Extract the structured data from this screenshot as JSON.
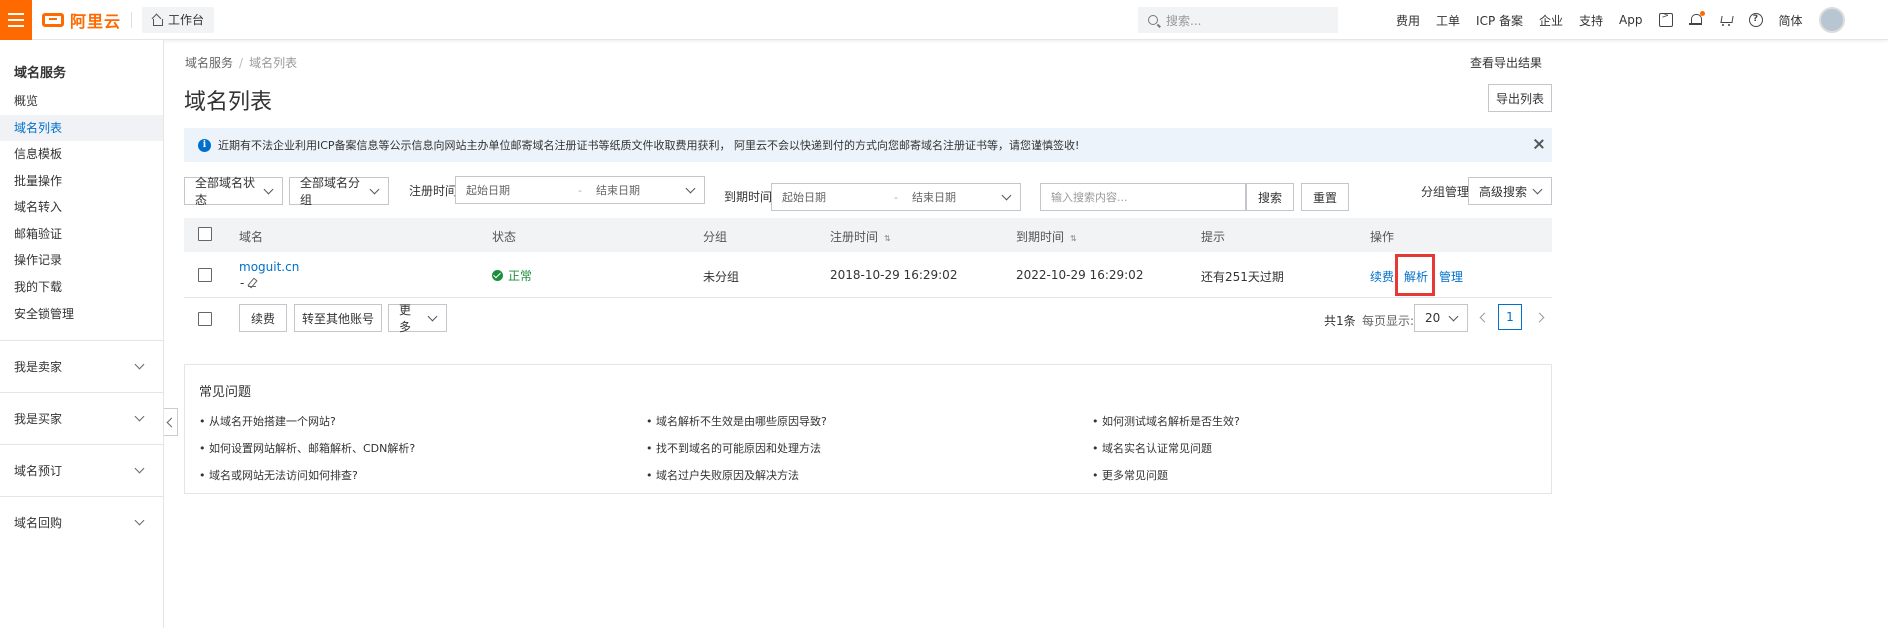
{
  "topbar": {
    "brand": "阿里云",
    "workbench": "工作台",
    "search_placeholder": "搜索...",
    "nav": [
      "费用",
      "工单",
      "ICP 备案",
      "企业",
      "支持",
      "App"
    ],
    "lang": "简体",
    "icons": [
      "terminal-icon",
      "bell-icon",
      "cart-icon",
      "help-icon"
    ]
  },
  "sidebar": {
    "title": "域名服务",
    "items": [
      "概览",
      "域名列表",
      "信息模板",
      "批量操作",
      "域名转入",
      "邮箱验证",
      "操作记录",
      "我的下载",
      "安全锁管理"
    ],
    "active_index": 1,
    "groups": [
      "我是卖家",
      "我是买家",
      "域名预订",
      "域名回购"
    ]
  },
  "breadcrumb": {
    "root": "域名服务",
    "current": "域名列表"
  },
  "header": {
    "title": "域名列表",
    "view_export": "查看导出结果",
    "export_button": "导出列表"
  },
  "notice": {
    "text": "近期有不法企业利用ICP备案信息等公示信息向网站主办单位邮寄域名注册证书等纸质文件收取费用获利， 阿里云不会以快递到付的方式向您邮寄域名注册证书等，请您谨慎签收!"
  },
  "filters": {
    "status_select": "全部域名状态",
    "group_select": "全部域名分组",
    "reg_label": "注册时间",
    "exp_label": "到期时间",
    "start_placeholder": "起始日期",
    "end_placeholder": "结束日期",
    "search_placeholder": "输入搜索内容...",
    "search_button": "搜索",
    "reset_button": "重置",
    "group_manage": "分组管理",
    "advanced_search": "高级搜索"
  },
  "table": {
    "columns": [
      "域名",
      "状态",
      "分组",
      "注册时间",
      "到期时间",
      "提示",
      "操作"
    ],
    "rows": [
      {
        "domain": "moguit.cn",
        "sub": "-",
        "status": "正常",
        "group": "未分组",
        "registered": "2018-10-29 16:29:02",
        "expires": "2022-10-29 16:29:02",
        "hint": "还有251天过期",
        "actions": [
          "续费",
          "解析",
          "管理"
        ]
      }
    ]
  },
  "bulk": {
    "renew": "续费",
    "transfer": "转至其他账号",
    "more": "更多"
  },
  "pagination": {
    "total": "共1条",
    "per_page_label": "每页显示:",
    "per_page": "20",
    "current_page": "1"
  },
  "faq": {
    "title": "常见问题",
    "items": [
      "• 从域名开始搭建一个网站?",
      "• 域名解析不生效是由哪些原因导致?",
      "• 如何测试域名解析是否生效?",
      "• 如何设置网站解析、邮箱解析、CDN解析?",
      "• 找不到域名的可能原因和处理方法",
      "• 域名实名认证常见问题",
      "• 域名或网站无法访问如何排查?",
      "• 域名过户失败原因及解决方法",
      "• 更多常见问题"
    ]
  },
  "colors": {
    "brand": "#ff6a00",
    "link": "#0070cc",
    "success": "#1e8e3e",
    "highlight": "#e53935"
  }
}
